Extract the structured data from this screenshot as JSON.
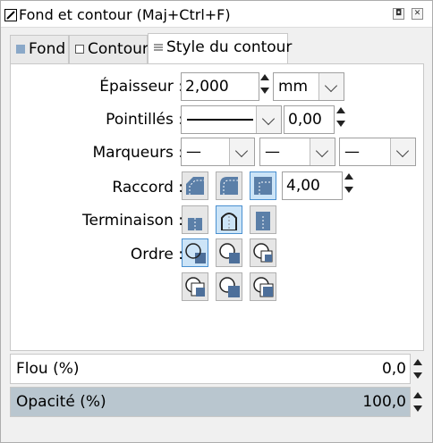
{
  "window": {
    "title": "Fond et contour (Maj+Ctrl+F)",
    "restore_symbol": "◘",
    "close_symbol": "✕"
  },
  "tabs": [
    {
      "label": "Fond",
      "active": false
    },
    {
      "label": "Contour",
      "active": false
    },
    {
      "label": "Style du contour",
      "active": true
    }
  ],
  "stroke_style": {
    "width": {
      "label": "Épaisseur :",
      "value": "2,000",
      "unit": "mm"
    },
    "dashes": {
      "label": "Pointillés :",
      "offset": "0,00"
    },
    "markers": {
      "label": "Marqueurs :",
      "start": "—",
      "mid": "—",
      "end": "—"
    },
    "join": {
      "label": "Raccord :",
      "options": [
        "bevel",
        "round",
        "miter"
      ],
      "selected": "miter",
      "miter_limit": "4,00"
    },
    "cap": {
      "label": "Terminaison :",
      "options": [
        "butt",
        "round",
        "square"
      ],
      "selected": "round"
    },
    "order": {
      "label": "Ordre :",
      "options": [
        "normal",
        "stroke-fill",
        "fill-markers-stroke",
        "markers-fill-stroke",
        "markers-stroke-fill",
        "stroke-markers-fill"
      ],
      "selected": "normal"
    }
  },
  "blur": {
    "label": "Flou (%)",
    "value": "0,0",
    "fill_fraction": 0.0
  },
  "opacity": {
    "label": "Opacité (%)",
    "value": "100,0",
    "fill_fraction": 1.0
  },
  "colors": {
    "selected_bg": "#cce4f7",
    "selected_border": "#4a90d0",
    "slider_fill": "#b9c6cf"
  }
}
